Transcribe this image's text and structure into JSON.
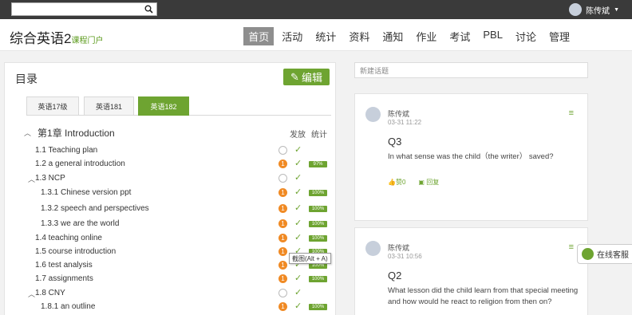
{
  "topbar": {
    "search_placeholder": "",
    "user_name": "陈传斌"
  },
  "brand": {
    "title": "综合英语2",
    "subtitle": "课程门户"
  },
  "nav": [
    "首页",
    "活动",
    "统计",
    "资料",
    "通知",
    "作业",
    "考试",
    "PBL",
    "讨论",
    "管理"
  ],
  "catalog": {
    "title": "目录",
    "edit_label": "编辑",
    "tabs": [
      "英语17级",
      "英语181",
      "英语182"
    ],
    "active_tab": 2,
    "col_publish": "发放",
    "col_stats": "统计",
    "chapter": "第1章 Introduction",
    "rows": [
      {
        "label": "1.1  Teaching plan",
        "caret": false,
        "indent": 0,
        "badge": "",
        "pct": ""
      },
      {
        "label": "1.2  a general introduction",
        "caret": false,
        "indent": 0,
        "badge": "1",
        "pct": "97%"
      },
      {
        "label": "1.3  NCP",
        "caret": true,
        "indent": 0,
        "badge": "",
        "pct": ""
      },
      {
        "label": "1.3.1 Chinese version ppt",
        "caret": false,
        "indent": 1,
        "badge": "1",
        "pct": "100%"
      },
      {
        "label": "1.3.2 speech and perspectives",
        "caret": false,
        "indent": 1,
        "badge": "1",
        "pct": "100%"
      },
      {
        "label": "1.3.3 we are the world",
        "caret": false,
        "indent": 1,
        "badge": "1",
        "pct": "100%"
      },
      {
        "label": "1.4  teaching online",
        "caret": false,
        "indent": 0,
        "badge": "1",
        "pct": "100%"
      },
      {
        "label": "1.5  course introduction",
        "caret": false,
        "indent": 0,
        "badge": "1",
        "pct": "100%"
      },
      {
        "label": "1.6  test analysis",
        "caret": false,
        "indent": 0,
        "badge": "1",
        "pct": "100%"
      },
      {
        "label": "1.7  assignments",
        "caret": false,
        "indent": 0,
        "badge": "1",
        "pct": "100%"
      },
      {
        "label": "1.8  CNY",
        "caret": true,
        "indent": 0,
        "badge": "",
        "pct": ""
      },
      {
        "label": "1.8.1 an outline",
        "caret": false,
        "indent": 1,
        "badge": "1",
        "pct": "100%"
      }
    ],
    "tooltip": "截图(Alt + A)"
  },
  "discussion": {
    "new_topic_placeholder": "新建话题",
    "posts": [
      {
        "name": "陈传斌",
        "time": "03-31 11:22",
        "title": "Q3",
        "body": "In what sense was the child（the writer） saved?",
        "like": "赞0",
        "reply": "回复"
      },
      {
        "name": "陈传斌",
        "time": "03-31 10:56",
        "title": "Q2",
        "body": "What lesson did the child learn from that special meeting and how would he react to religion from then on?",
        "like": "",
        "reply": ""
      }
    ]
  },
  "service": {
    "label": "在线客服"
  },
  "colors": {
    "accent": "#6ea431",
    "badge": "#f08a24",
    "topbar": "#3a3a3a"
  }
}
